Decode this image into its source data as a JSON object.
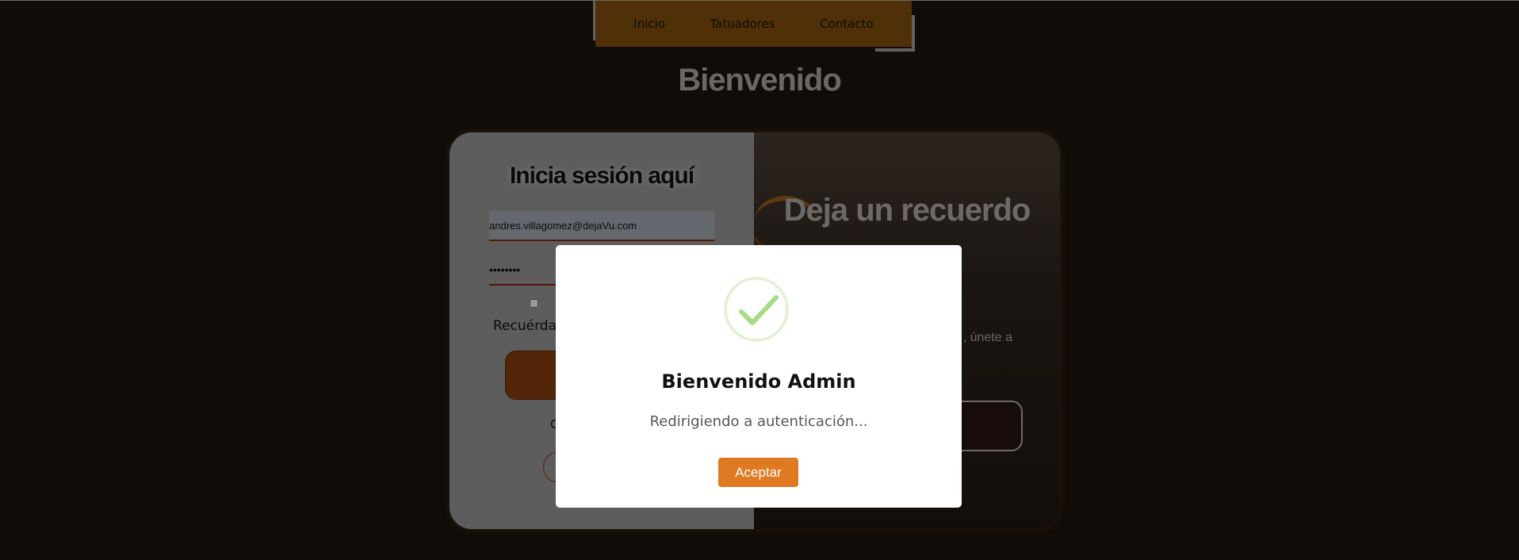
{
  "nav": {
    "items": [
      "Inicio",
      "Tatuadores",
      "Contacto"
    ]
  },
  "page": {
    "title": "Bienvenido"
  },
  "login": {
    "title": "Inicia sesión aquí",
    "email_value": "andres.villagomez@dejaVu.com",
    "password_value": "••••••••",
    "remember_label": "Recuérdan",
    "partial_text": "C"
  },
  "register": {
    "title": "Deja un recuerdo",
    "text": ", únete a"
  },
  "modal": {
    "title": "Bienvenido Admin",
    "text": "Redirigiendo a autenticación...",
    "button_label": "Aceptar",
    "icon": "success-check-icon",
    "icon_color": "#a5dc86"
  },
  "colors": {
    "background": "#1b140e",
    "nav": "#84500e",
    "accent": "#e07a22"
  }
}
